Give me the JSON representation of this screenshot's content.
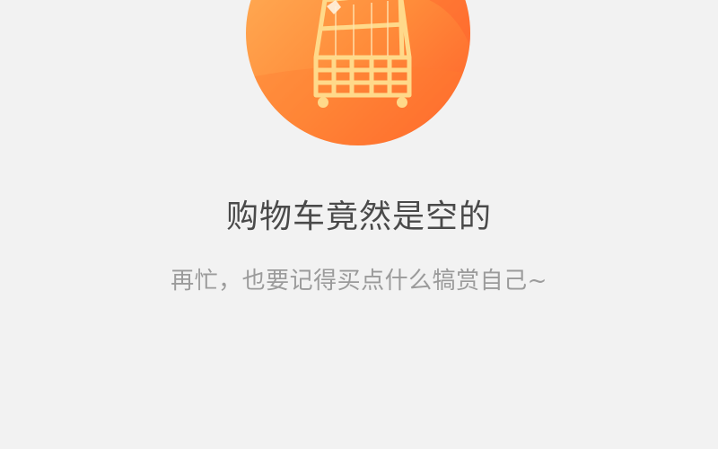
{
  "empty_cart": {
    "title": "购物车竟然是空的",
    "subtitle": "再忙，也要记得买点什么犒赏自己~"
  },
  "colors": {
    "background": "#f2f2f2",
    "circle_light": "#ffa24a",
    "circle_dark": "#ff6a2a",
    "cart": "#ffd98a",
    "title_text": "#4a4a4a",
    "subtitle_text": "#9b9b9b"
  },
  "icons": {
    "illustration": "empty-shopping-cart-icon"
  }
}
